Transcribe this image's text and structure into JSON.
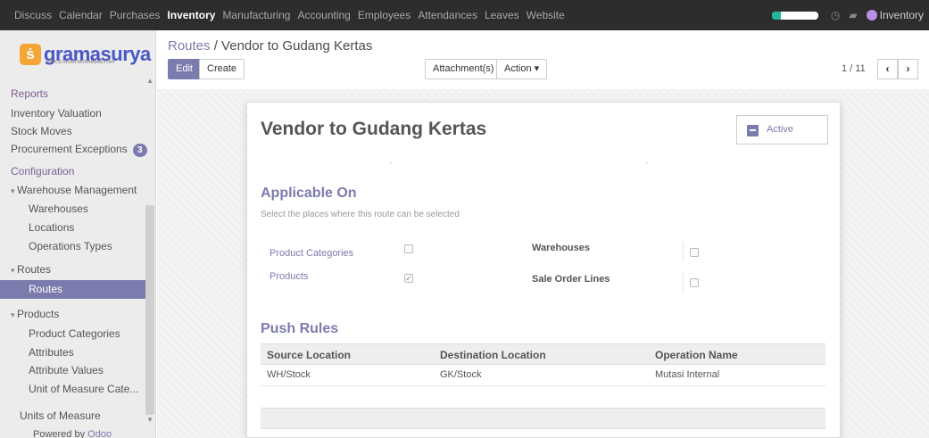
{
  "topbar": {
    "menus": [
      "Discuss",
      "Calendar",
      "Purchases",
      "Inventory",
      "Manufacturing",
      "Accounting",
      "Employees",
      "Attendances",
      "Leaves",
      "Website"
    ],
    "active_menu": "Inventory",
    "user": "Inventory",
    "progress": 0.2,
    "icons": [
      "clock-icon",
      "chat-icon"
    ]
  },
  "sidebar": {
    "logo_text": "gramasurya",
    "logo_sub": "PERCETAKAN MUHAMMADIYAH",
    "reports_title": "Reports",
    "reports": [
      "Inventory Valuation",
      "Stock Moves",
      "Procurement Exceptions"
    ],
    "procurement_badge": "3",
    "configuration_title": "Configuration",
    "warehouse_group": "Warehouse Management",
    "warehouse_items": [
      "Warehouses",
      "Locations",
      "Operations Types"
    ],
    "routes_group": "Routes",
    "routes_item": "Routes",
    "products_group": "Products",
    "products_items": [
      "Product Categories",
      "Attributes",
      "Attribute Values",
      "Unit of Measure Cate..."
    ],
    "units": "Units of Measure",
    "powered_by": "Powered by",
    "powered_brand": "Odoo"
  },
  "control": {
    "breadcrumb_parent": "Routes",
    "breadcrumb_sep": " / ",
    "breadcrumb_current": "Vendor to Gudang Kertas",
    "edit_label": "Edit",
    "create_label": "Create",
    "attachment_label": "Attachment(s) ▾",
    "action_label": "Action ▾",
    "pager": "1 / 11"
  },
  "form": {
    "title": "Vendor to Gudang Kertas",
    "active_label": "Active",
    "applicable_title": "Applicable On",
    "applicable_hint": "Select the places where this route can be selected",
    "product_categories_label": "Product Categories",
    "products_label": "Products",
    "warehouses_label": "Warehouses",
    "sale_order_lines_label": "Sale Order Lines",
    "product_categories_checked": false,
    "products_checked": true,
    "warehouses_checked": false,
    "sale_order_lines_checked": false,
    "push_title": "Push Rules",
    "columns": [
      "Source Location",
      "Destination Location",
      "Operation Name"
    ],
    "rows": [
      [
        "WH/Stock",
        "GK/Stock",
        "Mutasi Internal"
      ]
    ]
  },
  "colors": {
    "accent": "#7c7bad",
    "topbar": "#2d2d2d",
    "logo": "#4a57c8",
    "logo_mark": "#f3a535"
  }
}
